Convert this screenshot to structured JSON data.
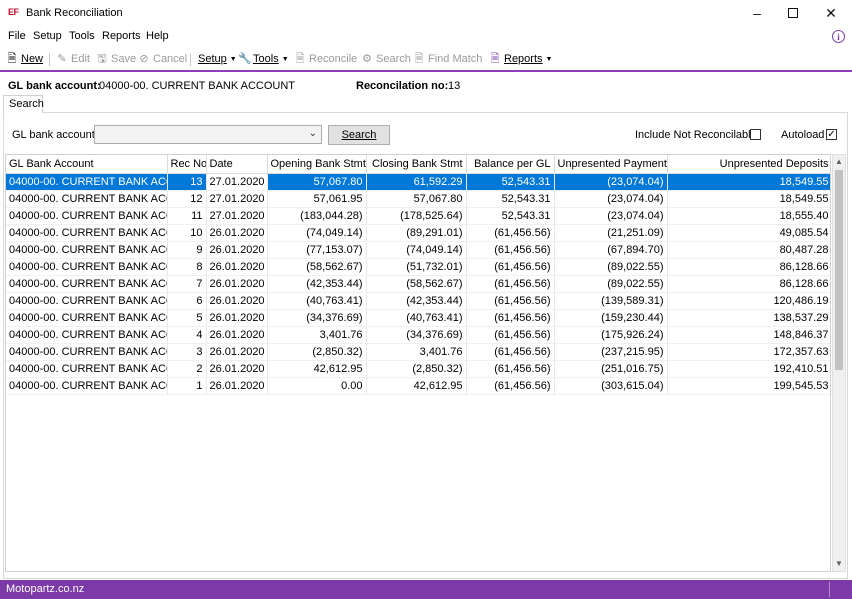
{
  "window": {
    "title": "Bank Reconciliation",
    "icon_text": "EF"
  },
  "menu": [
    "File",
    "Setup",
    "Tools",
    "Reports",
    "Help"
  ],
  "toolbar": {
    "new": "New",
    "edit": "Edit",
    "save": "Save",
    "cancel": "Cancel",
    "setup": "Setup",
    "tools": "Tools",
    "reconcile": "Reconcile",
    "search": "Search",
    "find_match": "Find Match",
    "reports": "Reports"
  },
  "header": {
    "gl_label": "GL bank account:",
    "gl_value": "04000-00. CURRENT BANK ACCOUNT",
    "rec_label": "Reconcilation no:",
    "rec_value": "13"
  },
  "tab": {
    "search": "Search"
  },
  "search_form": {
    "gl_label": "GL bank account:",
    "gl_value": "",
    "search_button": "Search",
    "include_label": "Include Not Reconcilable",
    "include_checked": false,
    "autoload_label": "Autoload",
    "autoload_checked": true
  },
  "grid": {
    "columns": [
      "GL Bank Account",
      "Rec No",
      "Date",
      "Opening Bank Stmt",
      "Closing Bank Stmt",
      "Balance per GL",
      "Unpresented Payments",
      "Unpresented Deposits"
    ],
    "rows": [
      [
        "04000-00. CURRENT BANK ACCO...",
        "13",
        "27.01.2020",
        "57,067.80",
        "61,592.29",
        "52,543.31",
        "(23,074.04)",
        "18,549.55"
      ],
      [
        "04000-00. CURRENT BANK ACCO...",
        "12",
        "27.01.2020",
        "57,061.95",
        "57,067.80",
        "52,543.31",
        "(23,074.04)",
        "18,549.55"
      ],
      [
        "04000-00. CURRENT BANK ACCO...",
        "11",
        "27.01.2020",
        "(183,044.28)",
        "(178,525.64)",
        "52,543.31",
        "(23,074.04)",
        "18,555.40"
      ],
      [
        "04000-00. CURRENT BANK ACCO...",
        "10",
        "26.01.2020",
        "(74,049.14)",
        "(89,291.01)",
        "(61,456.56)",
        "(21,251.09)",
        "49,085.54"
      ],
      [
        "04000-00. CURRENT BANK ACCO...",
        "9",
        "26.01.2020",
        "(77,153.07)",
        "(74,049.14)",
        "(61,456.56)",
        "(67,894.70)",
        "80,487.28"
      ],
      [
        "04000-00. CURRENT BANK ACCO...",
        "8",
        "26.01.2020",
        "(58,562.67)",
        "(51,732.01)",
        "(61,456.56)",
        "(89,022.55)",
        "86,128.66"
      ],
      [
        "04000-00. CURRENT BANK ACCO...",
        "7",
        "26.01.2020",
        "(42,353.44)",
        "(58,562.67)",
        "(61,456.56)",
        "(89,022.55)",
        "86,128.66"
      ],
      [
        "04000-00. CURRENT BANK ACCO...",
        "6",
        "26.01.2020",
        "(40,763.41)",
        "(42,353.44)",
        "(61,456.56)",
        "(139,589.31)",
        "120,486.19"
      ],
      [
        "04000-00. CURRENT BANK ACCO...",
        "5",
        "26.01.2020",
        "(34,376.69)",
        "(40,763.41)",
        "(61,456.56)",
        "(159,230.44)",
        "138,537.29"
      ],
      [
        "04000-00. CURRENT BANK ACCO...",
        "4",
        "26.01.2020",
        "3,401.76",
        "(34,376.69)",
        "(61,456.56)",
        "(175,926.24)",
        "148,846.37"
      ],
      [
        "04000-00. CURRENT BANK ACCO...",
        "3",
        "26.01.2020",
        "(2,850.32)",
        "3,401.76",
        "(61,456.56)",
        "(237,215.95)",
        "172,357.63"
      ],
      [
        "04000-00. CURRENT BANK ACCO...",
        "2",
        "26.01.2020",
        "42,612.95",
        "(2,850.32)",
        "(61,456.56)",
        "(251,016.75)",
        "192,410.51"
      ],
      [
        "04000-00. CURRENT BANK ACCO...",
        "1",
        "26.01.2020",
        "0.00",
        "42,612.95",
        "(61,456.56)",
        "(303,615.04)",
        "199,545.53"
      ]
    ],
    "selected_row": 0
  },
  "status": {
    "text": "Motopartz.co.nz"
  },
  "colors": {
    "accent": "#8e3fbd",
    "status_bar": "#7c3aa8",
    "selection": "#0078d7"
  }
}
